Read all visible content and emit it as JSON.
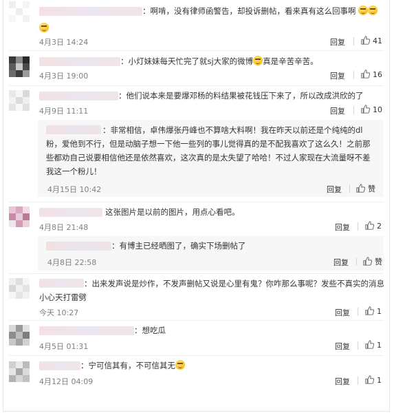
{
  "actions": {
    "reply_label": "回复",
    "like_label": "赞"
  },
  "comments": [
    {
      "text": "：啊啃，没有律师函警告，却投诉删帖，看来真有这么回事啊",
      "time": "4月3日 14:24",
      "likes": "41"
    },
    {
      "text": "：小灯妹妹每天忙完了就sj大家的微博",
      "text_tail": "真是辛苦辛苦。",
      "time": "4月3日 19:00",
      "likes": "16"
    },
    {
      "text": "：他们说本来是要爆邓杨的料结果被花钱压下来了，所以改成洪欣的了",
      "time": "4月9日 11:11",
      "likes": "10"
    },
    {
      "text": "：非常相信，卓伟爆张丹峰也不算啥大料啊！我在昨天以前还是个纯纯的dl粉，爱他到不行，但是动脑子想一下他一些列的事儿觉得真的是不配我喜欢了这么久！之前那些都劝自己说要相信他还是依然喜欢，这次真的是太失望了哈哈！不过人家现在大流量呀不差我这一个粉儿！",
      "time": "4月15日 10:42",
      "likes": ""
    },
    {
      "text": "这张图片是以前的图片，用点心看吧。",
      "time": "4月8日 21:48",
      "likes": "2"
    },
    {
      "text": "：有博主已经晒图了，确实下场删帖了",
      "time": "4月8日 22:58",
      "likes": ""
    },
    {
      "text": "：出来发声说是炒作，不发声删帖又说是心里有鬼？你咋那么事呢？发些不真实的消息小心天打雷劈",
      "time": "今天 10:27",
      "likes": "1"
    },
    {
      "text": "：想吃瓜",
      "time": "4月5日 01:31",
      "likes": "1"
    },
    {
      "text": "：宁可信其有，不可信其无",
      "time": "4月12日 04:09",
      "likes": "1"
    }
  ]
}
